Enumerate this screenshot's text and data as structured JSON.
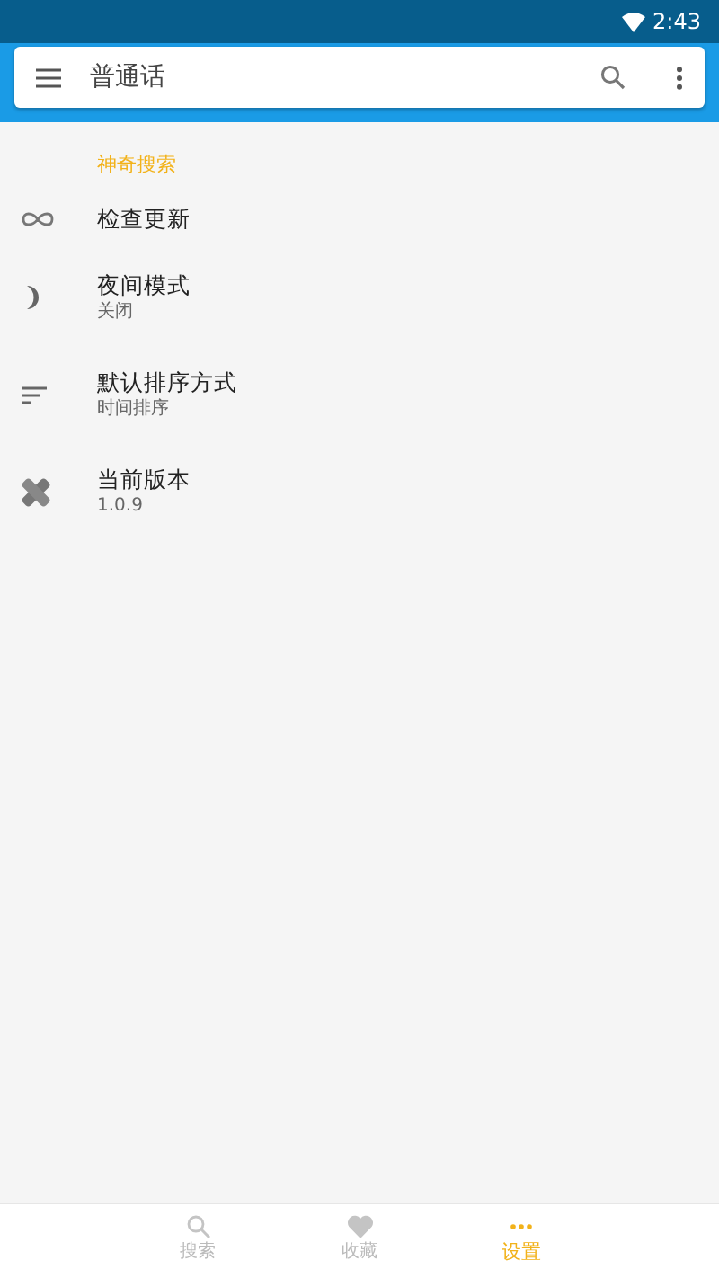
{
  "status_bar": {
    "time": "2:43"
  },
  "search_bar": {
    "value": "普通话"
  },
  "section": {
    "title": "神奇搜索"
  },
  "settings": [
    {
      "title": "检查更新"
    },
    {
      "title": "夜间模式",
      "subtitle": "关闭"
    },
    {
      "title": "默认排序方式",
      "subtitle": "时间排序"
    },
    {
      "title": "当前版本",
      "subtitle": "1.0.9"
    }
  ],
  "bottom_nav": [
    {
      "label": "搜索",
      "selected": false
    },
    {
      "label": "收藏",
      "selected": false
    },
    {
      "label": "设置",
      "selected": true
    }
  ]
}
